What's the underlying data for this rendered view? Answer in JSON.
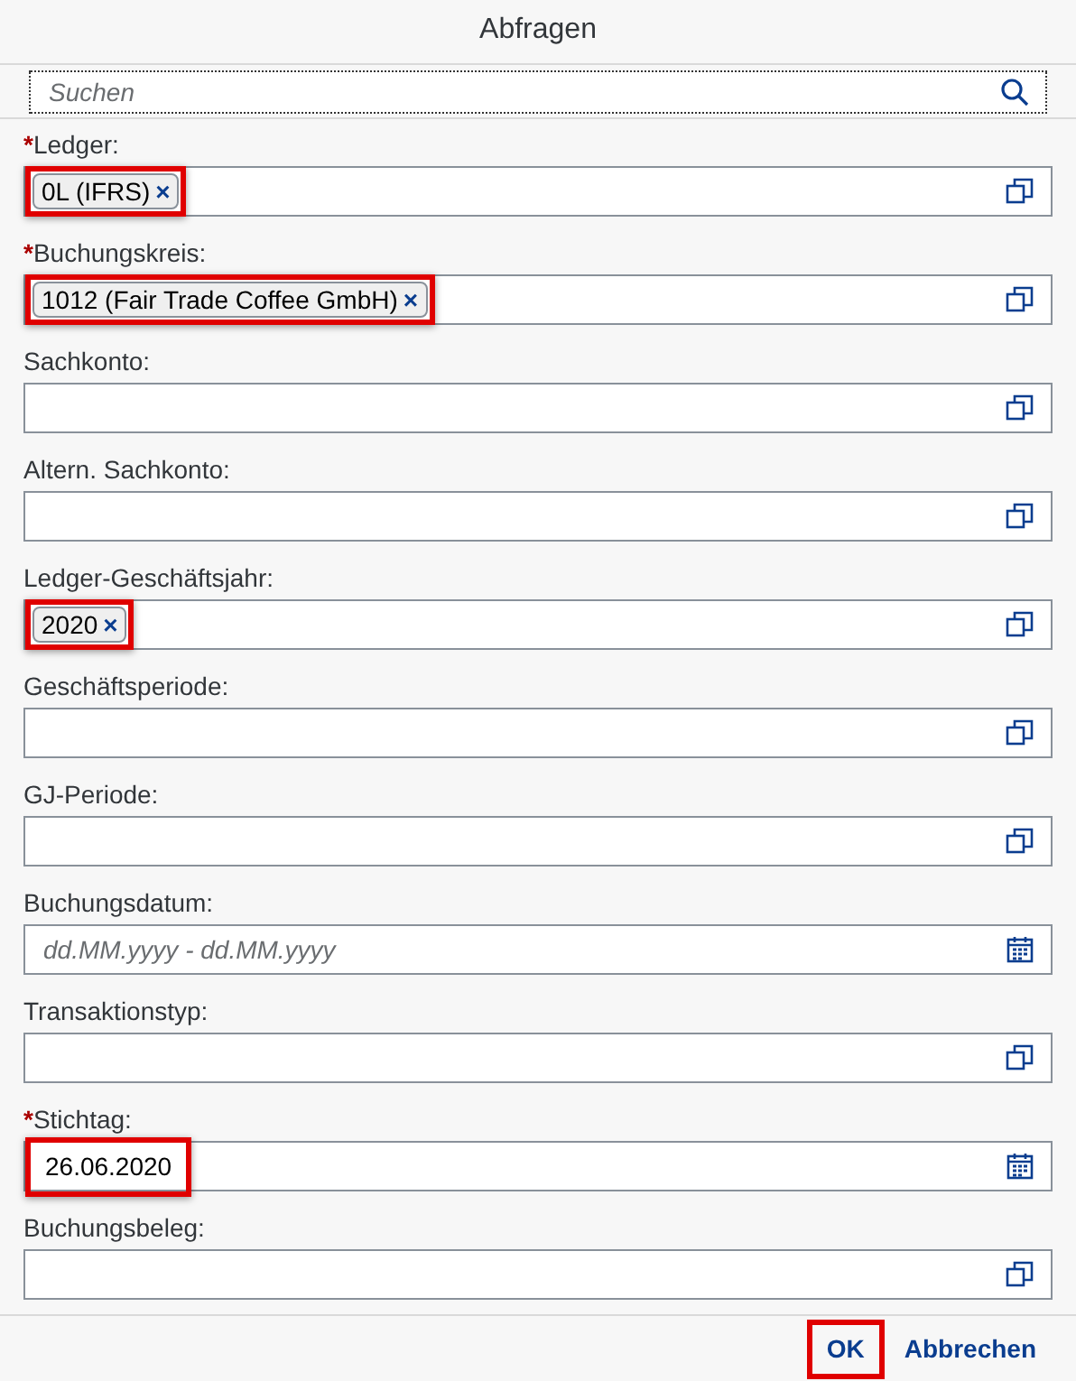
{
  "dialog": {
    "title": "Abfragen"
  },
  "search": {
    "placeholder": "Suchen"
  },
  "fields": [
    {
      "label": "Ledger:",
      "required_mark": "*",
      "kind": "value-help",
      "tokens": [
        {
          "text": "0L (IFRS)",
          "remove": "×"
        }
      ],
      "highlighted": true
    },
    {
      "label": "Buchungskreis:",
      "required_mark": "*",
      "kind": "value-help",
      "tokens": [
        {
          "text": "1012 (Fair Trade Coffee GmbH)",
          "remove": "×"
        }
      ],
      "highlighted": true
    },
    {
      "label": "Sachkonto:",
      "kind": "value-help"
    },
    {
      "label": "Altern. Sachkonto:",
      "kind": "value-help"
    },
    {
      "label": "Ledger-Geschäftsjahr:",
      "kind": "value-help",
      "tokens": [
        {
          "text": "2020",
          "remove": "×"
        }
      ],
      "highlighted": true
    },
    {
      "label": "Geschäftsperiode:",
      "kind": "value-help"
    },
    {
      "label": "GJ-Periode:",
      "kind": "value-help"
    },
    {
      "label": "Buchungsdatum:",
      "kind": "date",
      "placeholder": "dd.MM.yyyy - dd.MM.yyyy"
    },
    {
      "label": "Transaktionstyp:",
      "kind": "value-help"
    },
    {
      "label": "Stichtag:",
      "required_mark": "*",
      "kind": "date",
      "value": "26.06.2020",
      "highlighted": true
    },
    {
      "label": "Buchungsbeleg:",
      "kind": "value-help"
    }
  ],
  "buttons": [
    {
      "label": "OK",
      "highlighted": true
    },
    {
      "label": "Abbrechen",
      "highlighted": false
    }
  ]
}
